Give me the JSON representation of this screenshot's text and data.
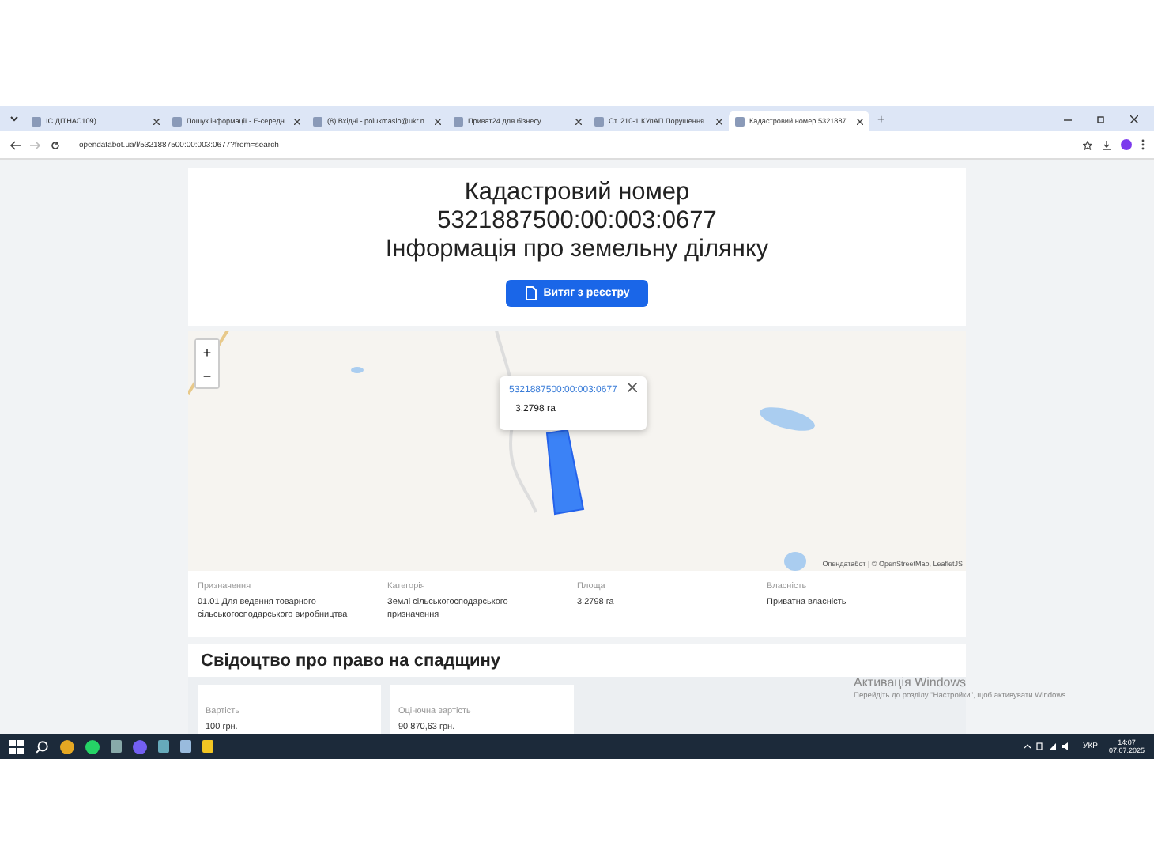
{
  "browser": {
    "tabs": [
      {
        "title": "ІС ДІТНАС109)",
        "selected": false
      },
      {
        "title": "Пошук інформації - Е-середн",
        "selected": false
      },
      {
        "title": "(8) Вхідні - polukmaslo@ukr.n",
        "selected": false
      },
      {
        "title": "Приват24 для бізнесу",
        "selected": false
      },
      {
        "title": "Ст. 210-1 КУпАП Порушення",
        "selected": false
      },
      {
        "title": "Кадастровий номер 5321887",
        "selected": true
      }
    ],
    "new_tab": "+",
    "url": "opendatabot.ua/l/5321887500:00:003:0677?from=search"
  },
  "header": {
    "title_lines": [
      "Кадастровий номер",
      "5321887500:00:003:0677",
      "Інформація про земельну ділянку"
    ],
    "button": "Витяг з реєстру"
  },
  "map": {
    "zoom_in": "+",
    "zoom_out": "−",
    "popup": {
      "link": "5321887500:00:003:0677",
      "area": "3.2798 га"
    },
    "attribution": "Опендатабот | © OpenStreetMap, LeafletJS"
  },
  "details": [
    {
      "label": "Призначення",
      "value": "01.01 Для ведення товарного сільськогосподарського виробництва"
    },
    {
      "label": "Категорія",
      "value": "Землі сільськогосподарського призначення"
    },
    {
      "label": "Площа",
      "value": "3.2798 га"
    },
    {
      "label": "Власність",
      "value": "Приватна власність"
    }
  ],
  "inheritance": {
    "title": "Свідоцтво про право на спадщину",
    "cards": [
      {
        "label": "Вартість",
        "value": "100 грн."
      },
      {
        "label": "Оціночна вартість",
        "value": "90 870,63 грн."
      }
    ]
  },
  "activation": {
    "title": "Активація Windows",
    "text": "Перейдіть до розділу \"Настройки\", щоб активувати Windows."
  },
  "taskbar": {
    "language": "УКР",
    "time": "14:07",
    "date": "07.07.2025"
  }
}
